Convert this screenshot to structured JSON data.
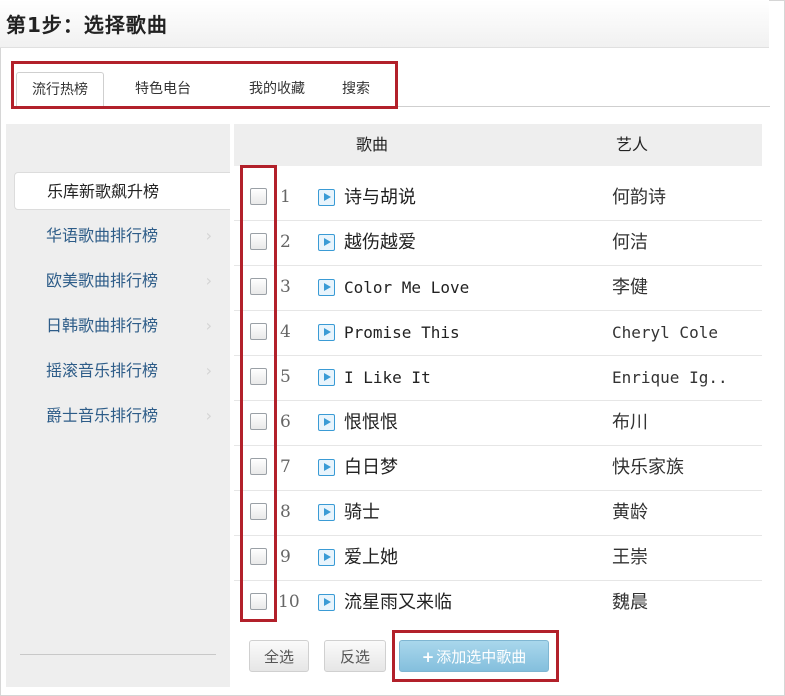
{
  "step_title": "第1步：选择歌曲",
  "tabs": [
    {
      "label": "流行热榜",
      "active": true
    },
    {
      "label": "特色电台",
      "active": false
    },
    {
      "label": "我的收藏",
      "active": false
    },
    {
      "label": "搜索",
      "active": false
    }
  ],
  "sidebar": {
    "items": [
      {
        "label": "乐库新歌飙升榜",
        "active": true
      },
      {
        "label": "华语歌曲排行榜",
        "active": false
      },
      {
        "label": "欧美歌曲排行榜",
        "active": false
      },
      {
        "label": "日韩歌曲排行榜",
        "active": false
      },
      {
        "label": "摇滚音乐排行榜",
        "active": false
      },
      {
        "label": "爵士音乐排行榜",
        "active": false
      }
    ]
  },
  "table": {
    "headers": {
      "song": "歌曲",
      "artist": "艺人"
    },
    "rows": [
      {
        "num": "1",
        "song": "诗与胡说",
        "artist": "何韵诗"
      },
      {
        "num": "2",
        "song": "越伤越爱",
        "artist": "何洁"
      },
      {
        "num": "3",
        "song": "Color Me Love",
        "artist": "李健"
      },
      {
        "num": "4",
        "song": "Promise This",
        "artist": "Cheryl Cole"
      },
      {
        "num": "5",
        "song": "I Like It",
        "artist": "Enrique Ig.."
      },
      {
        "num": "6",
        "song": "恨恨恨",
        "artist": "布川"
      },
      {
        "num": "7",
        "song": "白日梦",
        "artist": "快乐家族"
      },
      {
        "num": "8",
        "song": "骑士",
        "artist": "黄龄"
      },
      {
        "num": "9",
        "song": "爱上她",
        "artist": "王崇"
      },
      {
        "num": "10",
        "song": "流星雨又来临",
        "artist": "魏晨"
      }
    ]
  },
  "buttons": {
    "select_all": "全选",
    "invert": "反选",
    "add_selected": "添加选中歌曲",
    "add_icon": "plus-icon"
  },
  "icons": {
    "play": "play-icon",
    "chevron": "chevron-right-icon"
  },
  "colors": {
    "highlight_box": "#b2202a",
    "link": "#2d5c88",
    "play": "#3a9bd5",
    "primary_button": "#84bfdd"
  }
}
